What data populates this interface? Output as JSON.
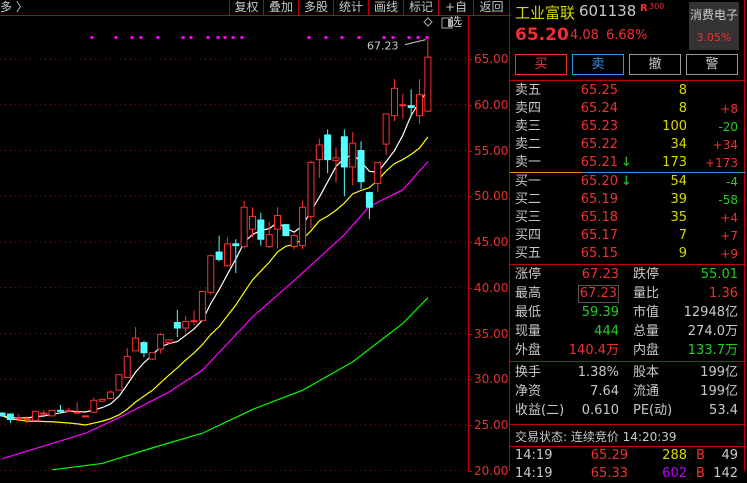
{
  "toolbar": {
    "more": "多 〉",
    "buttons": [
      "复权",
      "叠加",
      "多股",
      "统计",
      "画线",
      "标记",
      "+自选",
      "返回"
    ]
  },
  "chart_data": {
    "type": "candlestick",
    "y_ticks": [
      "65.00",
      "60.00",
      "55.00",
      "50.00",
      "45.00",
      "40.00",
      "35.00",
      "30.00",
      "25.00",
      "20.00"
    ],
    "high_annotation": "67.23",
    "candles": [
      [
        26.3,
        26.4,
        25.9,
        26.0
      ],
      [
        26.2,
        26.2,
        25.2,
        25.6
      ],
      [
        25.8,
        26.2,
        25.4,
        25.8
      ],
      [
        25.7,
        26.0,
        25.2,
        25.7
      ],
      [
        25.5,
        26.5,
        25.5,
        26.5
      ],
      [
        26.3,
        26.6,
        26.0,
        26.3
      ],
      [
        26.0,
        26.6,
        26.0,
        26.6
      ],
      [
        26.6,
        27.2,
        26.3,
        26.5
      ],
      [
        26.6,
        26.9,
        26.4,
        26.6
      ],
      [
        26.4,
        27.5,
        26.3,
        26.4
      ],
      [
        25.9,
        26.0,
        25.9,
        26.0
      ],
      [
        26.4,
        28.0,
        26.4,
        27.7
      ],
      [
        27.6,
        27.9,
        27.5,
        27.8
      ],
      [
        27.9,
        28.8,
        27.9,
        28.6
      ],
      [
        28.8,
        30.5,
        28.8,
        30.5
      ],
      [
        30.2,
        33.4,
        30.2,
        32.5
      ],
      [
        33.1,
        35.7,
        33.1,
        34.5
      ],
      [
        34.0,
        34.2,
        32.4,
        32.9
      ],
      [
        32.2,
        32.9,
        32.1,
        32.9
      ],
      [
        33.3,
        35.0,
        32.8,
        34.9
      ],
      [
        34.0,
        34.4,
        33.8,
        34.3
      ],
      [
        36.2,
        37.6,
        34.6,
        35.6
      ],
      [
        35.6,
        36.9,
        35.1,
        36.3
      ],
      [
        36.4,
        37.5,
        35.9,
        36.4
      ],
      [
        36.4,
        39.6,
        36.4,
        39.6
      ],
      [
        39.5,
        43.6,
        39.2,
        43.5
      ],
      [
        43.9,
        45.7,
        42.9,
        43.1
      ],
      [
        42.4,
        45.5,
        42.4,
        44.8
      ],
      [
        44.8,
        45.3,
        41.6,
        44.6
      ],
      [
        44.5,
        49.5,
        44.3,
        48.8
      ],
      [
        46.4,
        48.8,
        45.5,
        47.8
      ],
      [
        47.4,
        48.2,
        44.6,
        45.3
      ],
      [
        44.5,
        47.2,
        44.3,
        45.8
      ],
      [
        46.4,
        48.8,
        44.3,
        47.9
      ],
      [
        46.9,
        46.9,
        45.7,
        45.7
      ],
      [
        44.5,
        45.9,
        44.2,
        45.7
      ],
      [
        44.6,
        49.5,
        44.2,
        48.8
      ],
      [
        47.8,
        53.9,
        46.5,
        53.7
      ],
      [
        54.0,
        56.3,
        52.0,
        55.6
      ],
      [
        56.7,
        57.3,
        52.5,
        54.0
      ],
      [
        53.9,
        55.3,
        51.5,
        54.2
      ],
      [
        56.5,
        57.3,
        50.0,
        53.2
      ],
      [
        53.2,
        57.0,
        51.2,
        55.8
      ],
      [
        55.0,
        56.0,
        50.8,
        51.6
      ],
      [
        50.4,
        50.5,
        47.5,
        48.8
      ],
      [
        51.4,
        53.7,
        50.5,
        53.7
      ],
      [
        55.7,
        59.0,
        54.5,
        59.0
      ],
      [
        58.8,
        62.8,
        58.2,
        61.8
      ],
      [
        60.0,
        61.2,
        58.5,
        60.0
      ],
      [
        59.9,
        61.7,
        58.7,
        59.7
      ],
      [
        58.8,
        62.8,
        57.9,
        61.1
      ],
      [
        59.3,
        67.23,
        59.39,
        65.2
      ]
    ],
    "ma20": [
      [
        0,
        21.3
      ],
      [
        10,
        24.1
      ],
      [
        14,
        25.8
      ],
      [
        20,
        28.6
      ],
      [
        24,
        31.0
      ],
      [
        30,
        36.8
      ],
      [
        35,
        40.8
      ],
      [
        41,
        45.8
      ],
      [
        44,
        48.9
      ],
      [
        48,
        50.7
      ],
      [
        51,
        53.8
      ]
    ],
    "ma60": [
      [
        6,
        20.1
      ],
      [
        12,
        20.8
      ],
      [
        18,
        22.5
      ],
      [
        24,
        24.1
      ],
      [
        30,
        26.7
      ],
      [
        36,
        28.8
      ],
      [
        42,
        31.9
      ],
      [
        48,
        36.1
      ],
      [
        51,
        38.9
      ]
    ],
    "colors": {
      "up": "#ff3030",
      "down": "#54ffff",
      "ma5": "#ffffff",
      "ma10": "#ffff00",
      "ma20": "#ff00ff",
      "ma60": "#00ff00"
    }
  },
  "quote": {
    "name": "工业富联",
    "code": "601138",
    "r_badge": "R",
    "r_num": "300",
    "sector": "消费电子",
    "sector_change": "3.05%",
    "price": "65.20",
    "change": "4.08",
    "change_pct": "6.68%"
  },
  "actions": {
    "buy": "买",
    "sell": "卖",
    "cancel": "撤",
    "alert": "警"
  },
  "asks": [
    {
      "label": "卖五",
      "price": "65.25",
      "vol": "8",
      "delta": ""
    },
    {
      "label": "卖四",
      "price": "65.24",
      "vol": "8",
      "delta": "+8"
    },
    {
      "label": "卖三",
      "price": "65.23",
      "vol": "100",
      "delta": "-20"
    },
    {
      "label": "卖二",
      "price": "65.22",
      "vol": "34",
      "delta": "+34"
    },
    {
      "label": "卖一",
      "price": "65.21",
      "vol": "173",
      "delta": "+173",
      "arrow": "↓"
    }
  ],
  "bids": [
    {
      "label": "买一",
      "price": "65.20",
      "vol": "54",
      "delta": "-4",
      "arrow": "↓"
    },
    {
      "label": "买二",
      "price": "65.19",
      "vol": "39",
      "delta": "-58"
    },
    {
      "label": "买三",
      "price": "65.18",
      "vol": "35",
      "delta": "+4"
    },
    {
      "label": "买四",
      "price": "65.17",
      "vol": "7",
      "delta": "+7"
    },
    {
      "label": "买五",
      "price": "65.15",
      "vol": "9",
      "delta": "+9"
    }
  ],
  "stats": [
    [
      "涨停",
      "67.23",
      "跌停",
      "55.01"
    ],
    [
      "最高",
      "67.23",
      "量比",
      "1.36"
    ],
    [
      "最低",
      "59.39",
      "市值",
      "12948亿"
    ],
    [
      "现量",
      "444",
      "总量",
      "274.0万"
    ],
    [
      "外盘",
      "140.4万",
      "内盘",
      "133.7万"
    ]
  ],
  "stats2": [
    [
      "换手",
      "1.38%",
      "股本",
      "199亿"
    ],
    [
      "净资",
      "7.64",
      "流通",
      "199亿"
    ],
    [
      "收益(二)",
      "0.610",
      "PE(动)",
      "53.4"
    ]
  ],
  "status": "交易状态: 连续竞价 14:20:39",
  "ticks": [
    {
      "time": "14:19",
      "price": "65.29",
      "vol": "288",
      "side": "B",
      "num": "49"
    },
    {
      "time": "14:19",
      "price": "65.33",
      "vol": "602",
      "side": "B",
      "num": "142"
    }
  ]
}
